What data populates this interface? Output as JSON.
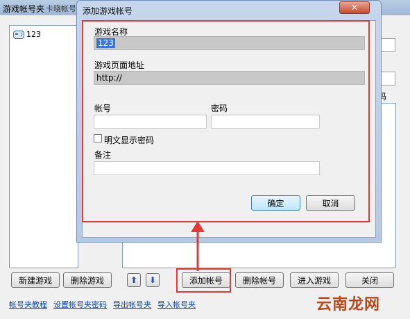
{
  "main_window": {
    "title": "游戏帐号夹",
    "title_overflow": "卡晓帐号…",
    "game_list": [
      "123"
    ],
    "password_column": "码"
  },
  "buttons": {
    "new_game": "新建游戏",
    "delete_game": "删除游戏",
    "move_up": "⬆",
    "move_down": "⬇",
    "add_account": "添加帐号",
    "delete_account": "删除帐号",
    "enter_game": "进入游戏",
    "close": "关闭"
  },
  "links": [
    "帐号夹教程",
    "设置帐号夹密码",
    "导出帐号夹",
    "导入帐号夹"
  ],
  "dialog": {
    "title": "添加游戏帐号",
    "close_symbol": "✕",
    "game_name_label": "游戏名称",
    "game_name_value": "123",
    "game_url_label": "游戏页面地址",
    "game_url_value": "http://",
    "account_label": "帐号",
    "account_value": "",
    "password_label": "密码",
    "password_value": "",
    "show_password_label": "明文显示密码",
    "show_password_checked": false,
    "note_label": "备注",
    "note_value": "",
    "ok_label": "确定",
    "cancel_label": "取消"
  },
  "watermark": "云南龙网",
  "colors": {
    "highlight": "#e53935",
    "link": "#0645ad"
  }
}
